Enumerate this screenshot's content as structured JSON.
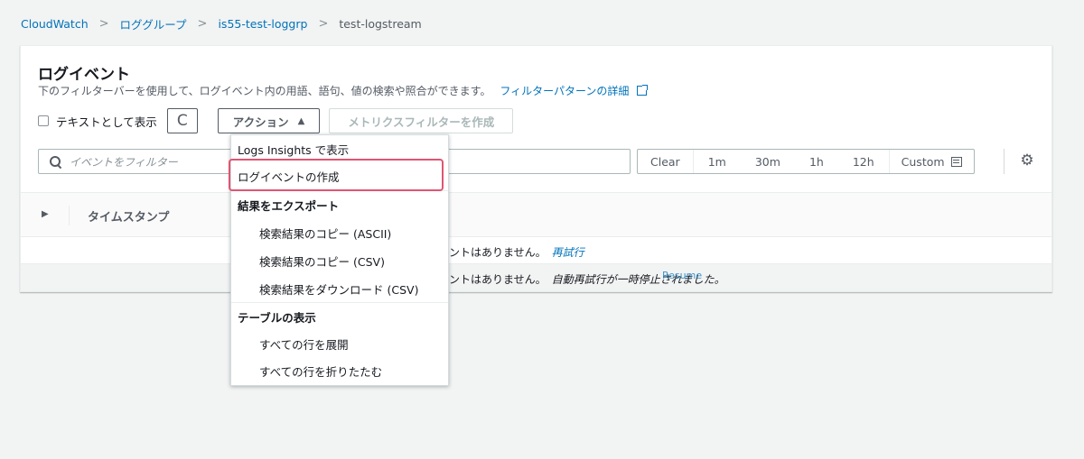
{
  "breadcrumb": {
    "items": [
      "CloudWatch",
      "ロググループ",
      "is55-test-loggrp"
    ],
    "current": "test-logstream",
    "separator": ">"
  },
  "panel": {
    "title": "ログイベント",
    "description": "下のフィルターバーを使用して、ログイベント内の用語、語句、値の検索や照合ができます。",
    "description_link": "フィルターパターンの詳細"
  },
  "controls": {
    "checkbox_label": "テキストとして表示",
    "refresh_icon": "C",
    "actions_label": "アクション",
    "actions_caret": "▲",
    "metric_filter_label": "メトリクスフィルターを作成"
  },
  "filter": {
    "placeholder": "イベントをフィルター"
  },
  "time_range": {
    "options": [
      "Clear",
      "1m",
      "30m",
      "1h",
      "12h",
      "Custom"
    ]
  },
  "table": {
    "expand_glyph": "▶",
    "timestamp_header": "タイムスタンプ",
    "row1_text": "ントはありません。",
    "row1_link": "再試行",
    "row2_text": "ントはありません。",
    "row2_italic": "自動再試行が一時停止されました。",
    "row2_link": "Resume"
  },
  "dropdown": {
    "items": [
      "Logs Insights で表示",
      "ログイベントの作成",
      "結果をエクスポート",
      "検索結果のコピー (ASCII)",
      "検索結果のコピー (CSV)",
      "検索結果をダウンロード (CSV)",
      "テーブルの表示",
      "すべての行を展開",
      "すべての行を折りたたむ"
    ]
  },
  "colors": {
    "link": "#0073bb",
    "highlight": "#e05572"
  },
  "icons": [
    "chevron-right-icon",
    "external-link-icon",
    "refresh-icon",
    "caret-up-icon",
    "search-icon",
    "calendar-icon",
    "gear-icon",
    "expand-icon"
  ]
}
